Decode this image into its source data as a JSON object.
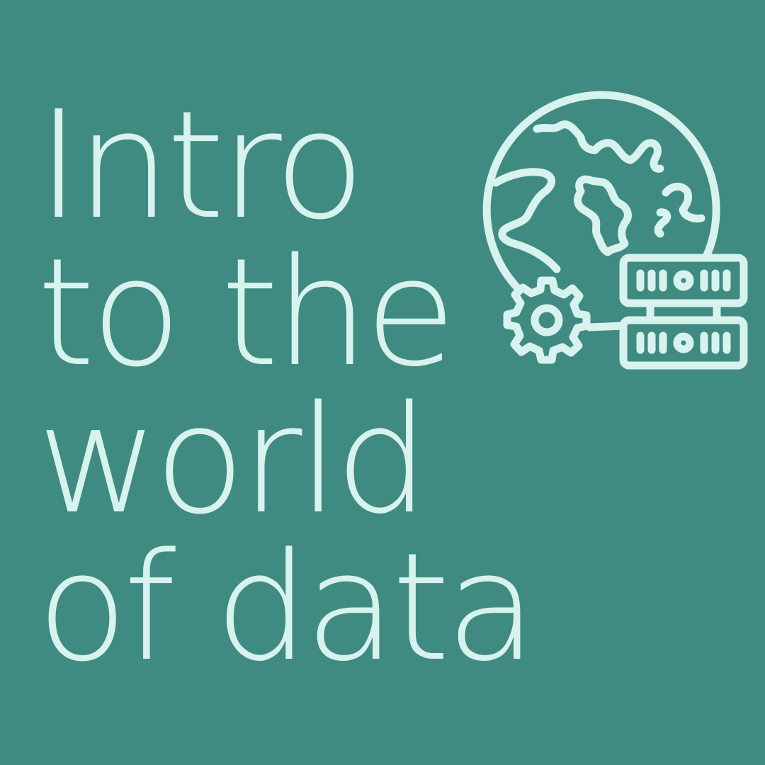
{
  "title": {
    "lines": [
      "Intro",
      "to the",
      "world",
      "of data"
    ]
  },
  "icon": {
    "name": "globe-data-server-gear-icon"
  },
  "colors": {
    "background": "#3f8b82",
    "foreground": "#d8f3ee"
  }
}
